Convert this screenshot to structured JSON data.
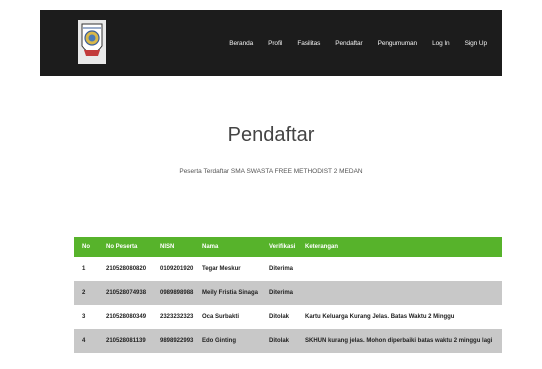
{
  "nav": {
    "items": [
      "Beranda",
      "Profil",
      "Fasilitas",
      "Pendaftar",
      "Pengumuman",
      "Log In",
      "Sign Up"
    ]
  },
  "page": {
    "title": "Pendaftar",
    "subtitle": "Peserta Terdaftar SMA SWASTA FREE METHODIST 2 MEDAN"
  },
  "table": {
    "headers": [
      "No",
      "No Peserta",
      "NISN",
      "Nama",
      "Verifikasi",
      "Keterangan"
    ],
    "rows": [
      [
        "1",
        "210528080820",
        "0109201920",
        "Tegar Meskur",
        "Diterima",
        ""
      ],
      [
        "2",
        "210528074938",
        "0989898988",
        "Meily Fristia Sinaga",
        "Diterima",
        ""
      ],
      [
        "3",
        "210528080349",
        "2323232323",
        "Oca Surbakti",
        "Ditolak",
        "Kartu Keluarga Kurang Jelas. Batas Waktu 2 Minggu"
      ],
      [
        "4",
        "210528081139",
        "9898922993",
        "Edo Ginting",
        "Ditolak",
        "SKHUN kurang jelas. Mohon diperbaiki batas waktu 2 minggu lagi"
      ]
    ]
  },
  "colors": {
    "navbar": "#1c1c1c",
    "header": "#57b32b",
    "row_alt": "#c8c8c8"
  },
  "icons": {
    "logo": "school-crest-logo"
  }
}
